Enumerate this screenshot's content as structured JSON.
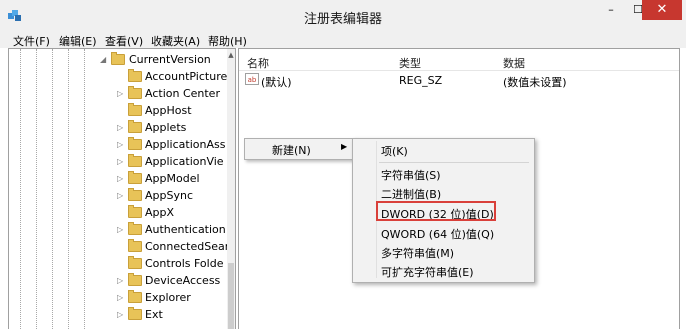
{
  "window": {
    "title": "注册表编辑器",
    "minimize": "–",
    "maximize": "☐",
    "close": "✕"
  },
  "menubar": [
    "文件(F)",
    "编辑(E)",
    "查看(V)",
    "收藏夹(A)",
    "帮助(H)"
  ],
  "tree": {
    "current": "CurrentVersion",
    "items": [
      "AccountPicture",
      "Action Center",
      "AppHost",
      "Applets",
      "ApplicationAss",
      "ApplicationVie",
      "AppModel",
      "AppSync",
      "AppX",
      "Authentication",
      "ConnectedSear",
      "Controls Folde",
      "DeviceAccess",
      "Explorer",
      "Ext"
    ]
  },
  "list": {
    "headers": [
      "名称",
      "类型",
      "数据"
    ],
    "rows": [
      {
        "name": "(默认)",
        "type": "REG_SZ",
        "data": "(数值未设置)"
      }
    ]
  },
  "context_menu": {
    "new_label": "新建(N)"
  },
  "submenu": {
    "items": [
      "项(K)",
      "字符串值(S)",
      "二进制值(B)",
      "DWORD (32 位)值(D)",
      "QWORD (64 位)值(Q)",
      "多字符串值(M)",
      "可扩充字符串值(E)"
    ]
  },
  "colors": {
    "highlight_border": "#d9403a",
    "folder": "#e8c358"
  }
}
